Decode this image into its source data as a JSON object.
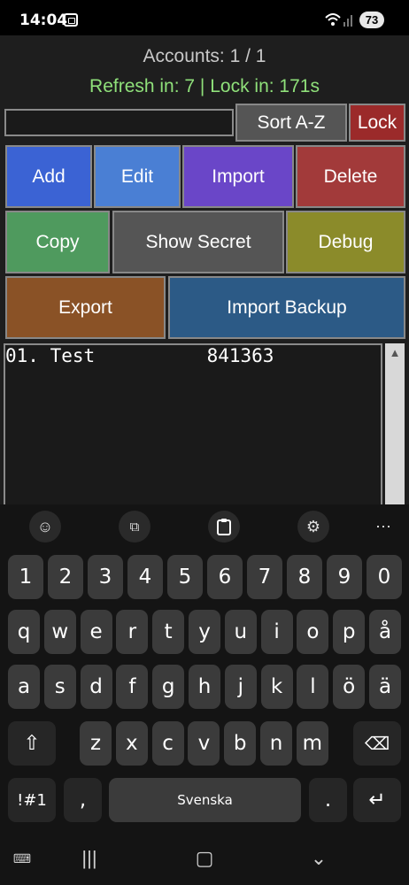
{
  "status_bar": {
    "time": "14:04",
    "battery": "73"
  },
  "app": {
    "accounts_text": "Accounts: 1 / 1",
    "refresh_text": "Refresh in: 7 | Lock in: 171s",
    "search_value": "",
    "buttons": {
      "sort": "Sort A-Z",
      "lock": "Lock",
      "add": "Add",
      "edit": "Edit",
      "import": "Import",
      "delete": "Delete",
      "copy": "Copy",
      "show_secret": "Show Secret",
      "debug": "Debug",
      "export": "Export",
      "import_backup": "Import Backup"
    },
    "accounts": [
      {
        "row": "01. Test          841363"
      }
    ]
  },
  "keyboard": {
    "toolbar": [
      "emoji-icon",
      "translate-icon",
      "clipboard-icon",
      "settings-icon",
      "more-icon"
    ],
    "row_numbers": [
      "1",
      "2",
      "3",
      "4",
      "5",
      "6",
      "7",
      "8",
      "9",
      "0"
    ],
    "row1": [
      "q",
      "w",
      "e",
      "r",
      "t",
      "y",
      "u",
      "i",
      "o",
      "p",
      "å"
    ],
    "row2": [
      "a",
      "s",
      "d",
      "f",
      "g",
      "h",
      "j",
      "k",
      "l",
      "ö",
      "ä"
    ],
    "row3": [
      "z",
      "x",
      "c",
      "v",
      "b",
      "n",
      "m"
    ],
    "symbols": "!#1",
    "comma": ",",
    "space": "Svenska",
    "period": "."
  }
}
